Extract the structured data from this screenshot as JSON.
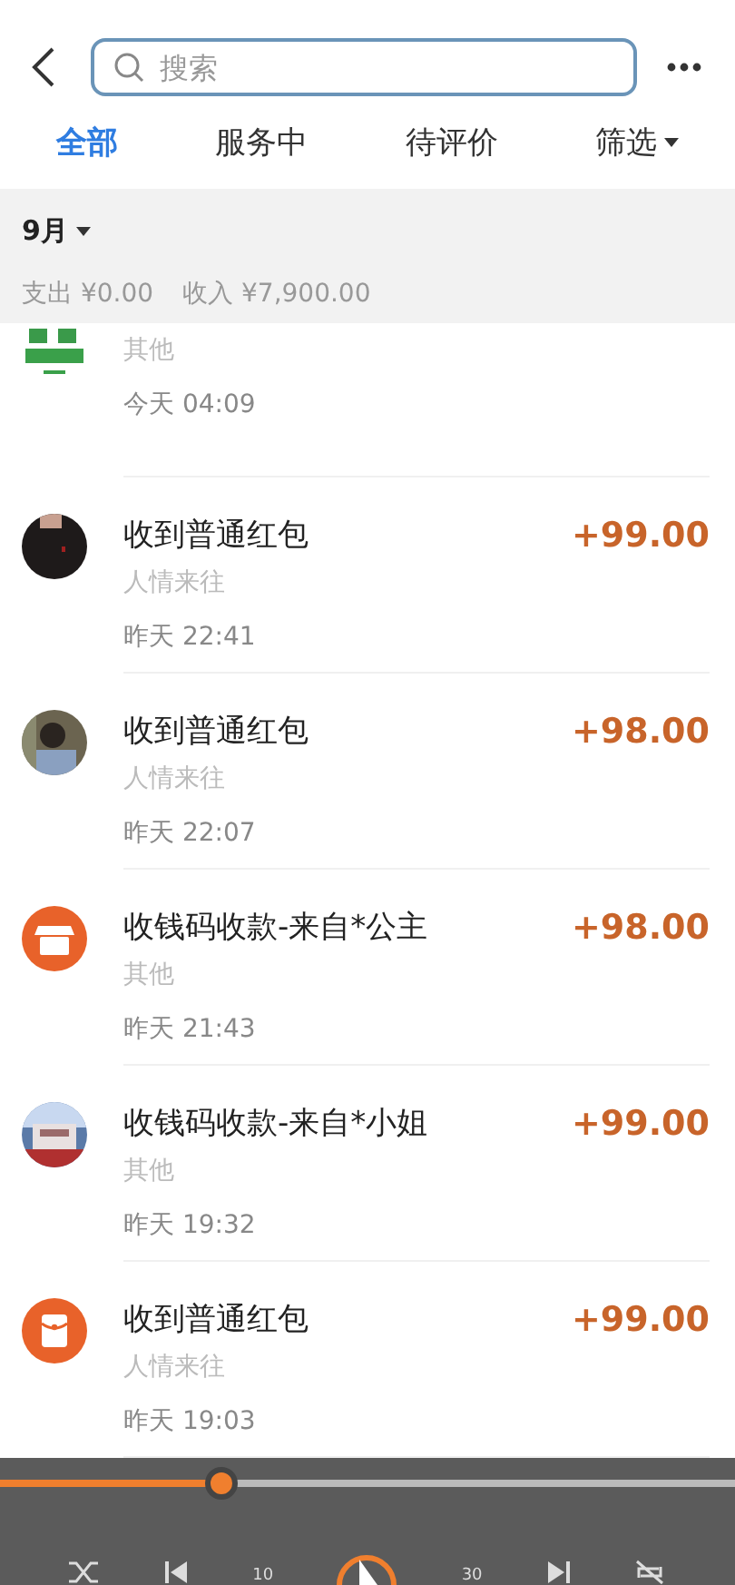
{
  "header": {
    "search": {
      "placeholder": "搜索"
    }
  },
  "tabs": [
    {
      "label": "全部",
      "selected": true
    },
    {
      "label": "服务中",
      "selected": false
    },
    {
      "label": "待评价",
      "selected": false
    },
    {
      "label": "筛选",
      "selected": false,
      "dropdown": true
    }
  ],
  "summary": {
    "month": "9月",
    "expense_label": "支出",
    "expense": "¥0.00",
    "income_label": "收入",
    "income": "¥7,900.00"
  },
  "transactions": [
    {
      "kind": "logo",
      "category": "其他",
      "time": "今天 04:09",
      "cut": true
    },
    {
      "kind": "photo-dark",
      "title": "收到普通红包",
      "category": "人情来往",
      "time": "昨天 22:41",
      "amount": "+99.00"
    },
    {
      "kind": "photo-person",
      "title": "收到普通红包",
      "category": "人情来往",
      "time": "昨天 22:07",
      "amount": "+98.00"
    },
    {
      "kind": "store",
      "title": "收钱码收款-来自*公主",
      "category": "其他",
      "time": "昨天 21:43",
      "amount": "+98.00"
    },
    {
      "kind": "photo-building",
      "title": "收钱码收款-来自*小姐",
      "category": "其他",
      "time": "昨天 19:32",
      "amount": "+99.00"
    },
    {
      "kind": "envelope",
      "title": "收到普通红包",
      "category": "人情来往",
      "time": "昨天 19:03",
      "amount": "+99.00"
    }
  ],
  "player": {
    "progress": {
      "level": 0.3
    },
    "rewind_label": "10",
    "forward_label": "30"
  }
}
